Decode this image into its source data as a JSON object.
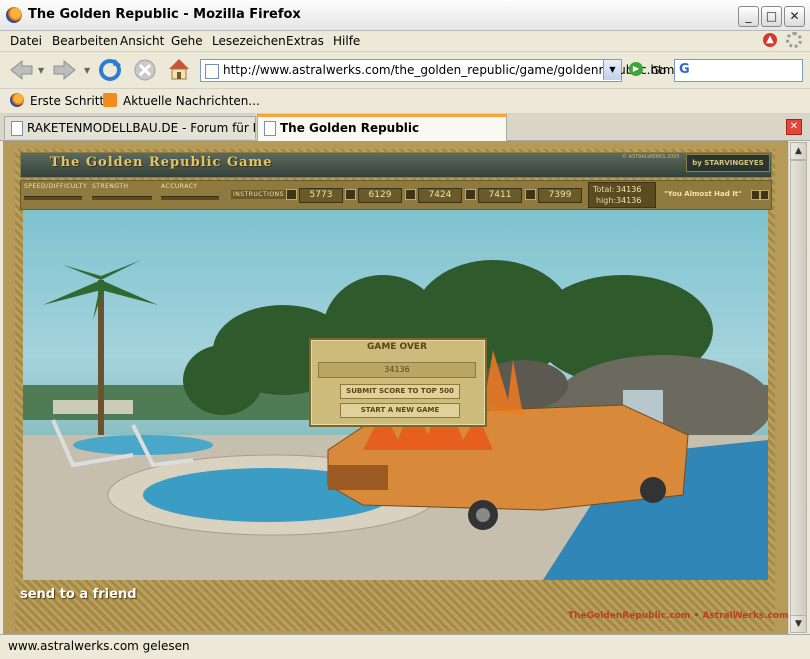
{
  "window": {
    "title": "The Golden Republic - Mozilla Firefox",
    "buttons": {
      "minimize": "_",
      "maximize": "□",
      "close": "✕"
    }
  },
  "menubar": {
    "items": [
      "Datei",
      "Bearbeiten",
      "Ansicht",
      "Gehe",
      "Lesezeichen",
      "Extras",
      "Hilfe"
    ],
    "accel": [
      "D",
      "B",
      "A",
      "G",
      "L",
      "E",
      "H"
    ]
  },
  "navbar": {
    "url": "http://www.astralwerks.com/the_golden_republic/game/goldenrepublic.htm",
    "go_label": "Go",
    "search_engine_letter": "G"
  },
  "bookmarks": {
    "items": [
      "Erste Schritte",
      "Aktuelle Nachrichten..."
    ]
  },
  "tabs": [
    {
      "label": "RAKETENMODELLBAU.DE - Forum für Experi...",
      "active": false
    },
    {
      "label": "The Golden Republic",
      "active": true
    }
  ],
  "game": {
    "title": "The Golden Republic Game",
    "credit_top": "© ASTRALWERKS 2005",
    "credit_by": "by STARVINGEYES",
    "controls": {
      "speed_label": "SPEED/DIFFICULTY",
      "strength_label": "STRENGTH",
      "accuracy_label": "ACCURACY",
      "instructions_label": "INSTRUCTIONS"
    },
    "scores": [
      "5773",
      "6129",
      "7424",
      "7411",
      "7399"
    ],
    "total_label": "Total:",
    "total_value": "34136",
    "high_label": "high:",
    "high_value": "34136",
    "track": "\"You Almost Had It\"",
    "game_over": {
      "title": "GAME OVER",
      "score": "34136",
      "submit_label": "SUBMIT SCORE TO TOP 500",
      "new_game_label": "START A NEW GAME"
    },
    "send_friend": "send to a friend",
    "footer_left": "TheGoldenRepublic.com",
    "footer_sep": "•",
    "footer_right": "AstralWerks.com"
  },
  "status": {
    "text": "www.astralwerks.com gelesen"
  },
  "colors": {
    "frame_gold": "#B59B57",
    "header_dark": "#34413A",
    "title_gold": "#E2C56A",
    "footer_red": "#C0392B"
  }
}
